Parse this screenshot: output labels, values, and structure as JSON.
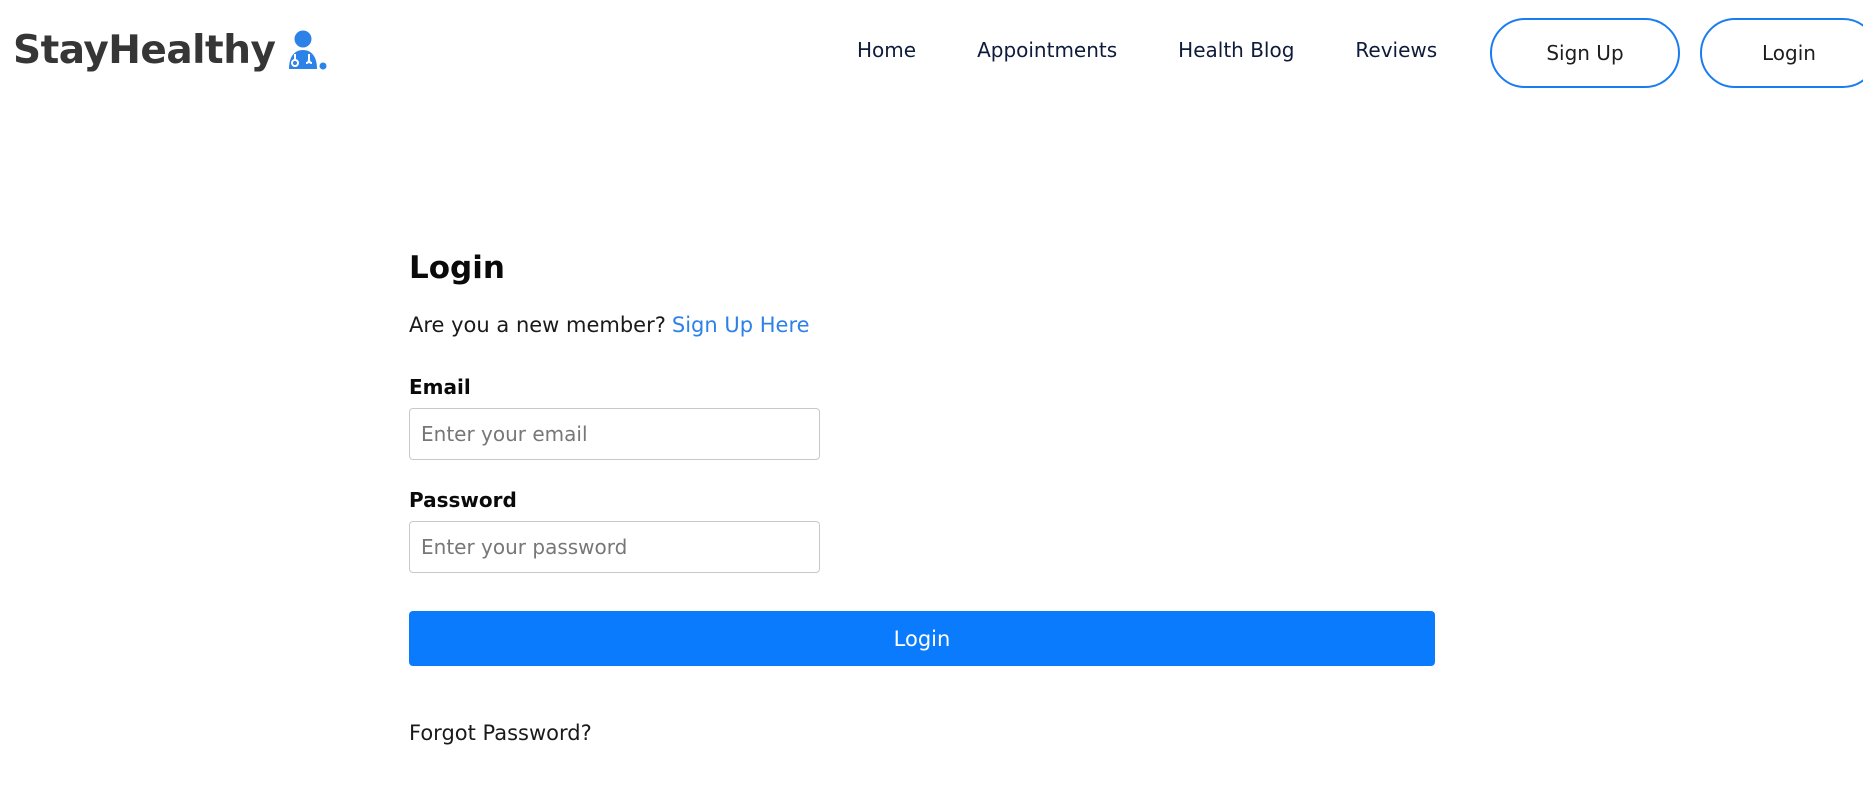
{
  "brand": {
    "name": "StayHealthy",
    "icon": "doctor-icon",
    "accent_color": "#2d82e8"
  },
  "nav": {
    "links": [
      "Home",
      "Appointments",
      "Health Blog",
      "Reviews"
    ],
    "signup_label": "Sign Up",
    "login_label": "Login",
    "button_border_color": "#1a7cf1"
  },
  "form": {
    "title": "Login",
    "member_prompt": "Are you a new member?",
    "signup_link": "Sign Up Here",
    "email_label": "Email",
    "email_placeholder": "Enter your email",
    "password_label": "Password",
    "password_placeholder": "Enter your password",
    "submit_label": "Login",
    "submit_color": "#0a7bfd",
    "forgot_label": "Forgot Password?"
  }
}
